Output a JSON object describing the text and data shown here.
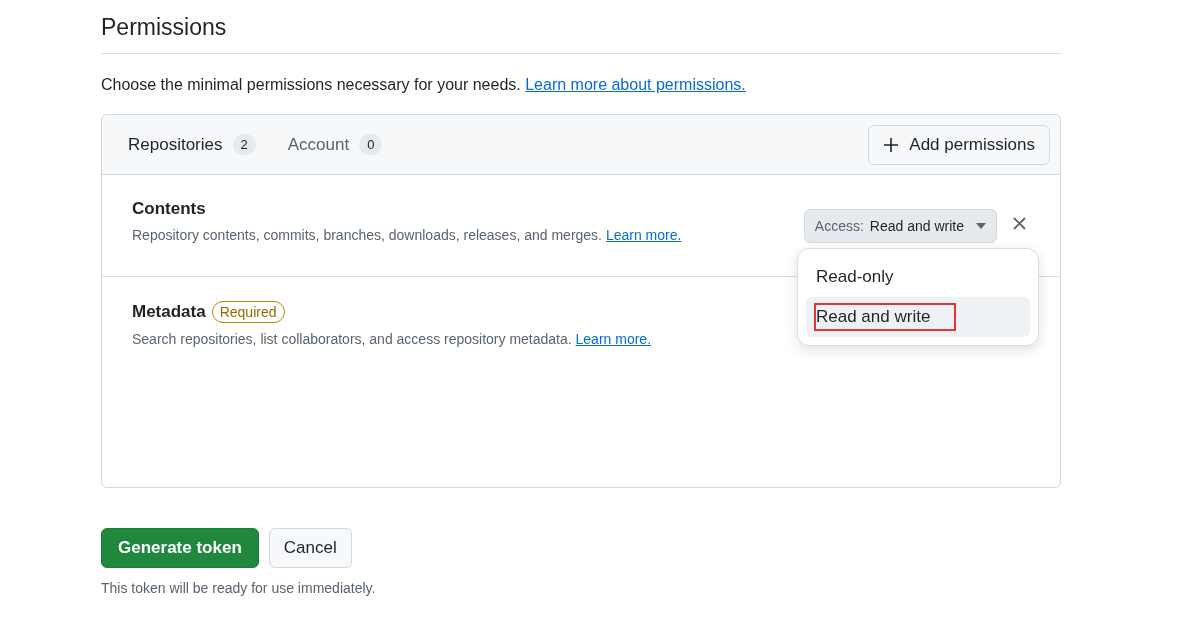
{
  "heading": "Permissions",
  "intro": {
    "text": "Choose the minimal permissions necessary for your needs.",
    "link": "Learn more about permissions."
  },
  "tabs": [
    {
      "label": "Repositories",
      "count": "2",
      "selected": true
    },
    {
      "label": "Account",
      "count": "0",
      "selected": false
    }
  ],
  "add_button": "Add permissions",
  "permissions": [
    {
      "name": "Contents",
      "description": "Repository contents, commits, branches, downloads, releases, and merges.",
      "link": "Learn more.",
      "access": {
        "label": "Access:",
        "value": "Read and write"
      }
    },
    {
      "name": "Metadata",
      "badge": "Required",
      "description": "Search repositories, list collaborators, and access repository metadata.",
      "link": "Learn more."
    }
  ],
  "access_menu": {
    "items": [
      {
        "label": "Read-only",
        "selected": false,
        "annotated": false
      },
      {
        "label": "Read and write",
        "selected": true,
        "annotated": true
      }
    ]
  },
  "buttons": {
    "primary": "Generate token",
    "secondary": "Cancel"
  },
  "note": "This token will be ready for use immediately."
}
